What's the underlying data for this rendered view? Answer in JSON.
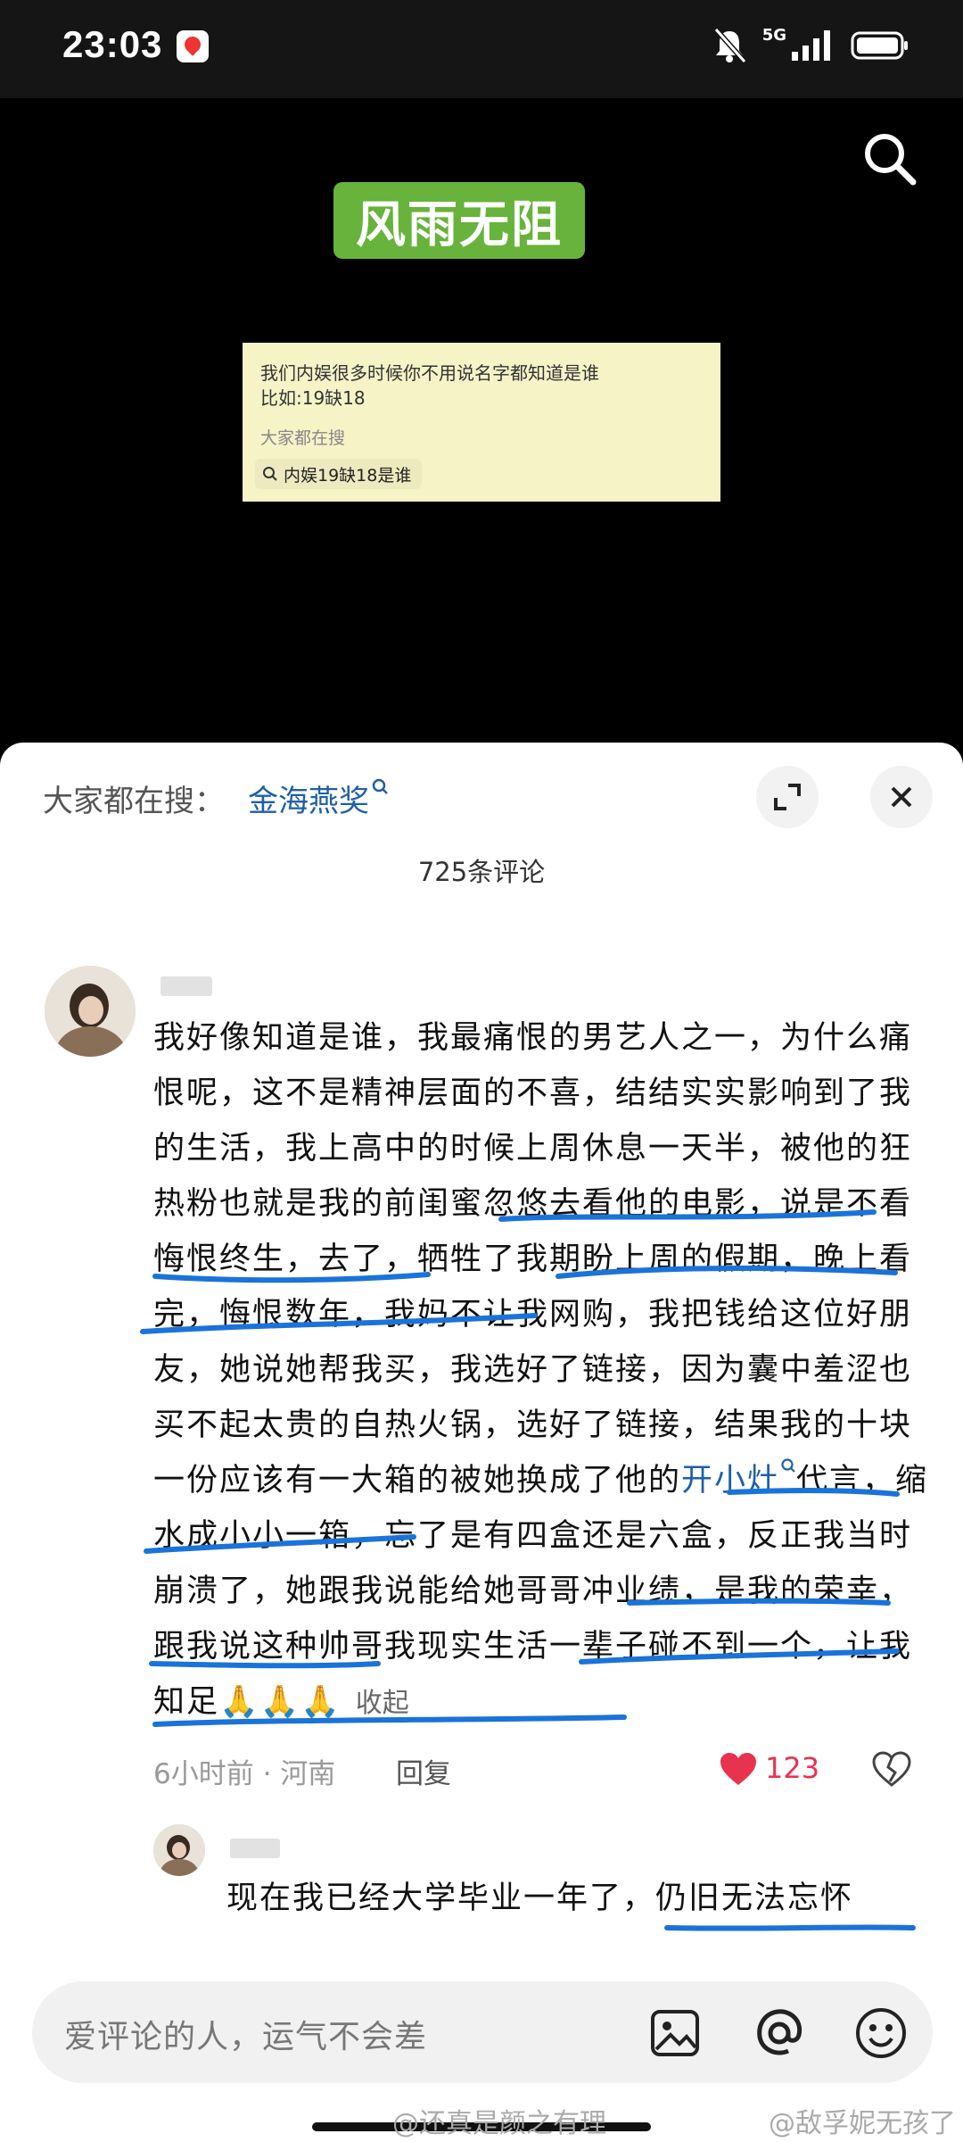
{
  "status_bar": {
    "time": "23:03",
    "network": "5G"
  },
  "video": {
    "tag": "风雨无阻",
    "card_line1": "我们内娱很多时候你不用说名字都知道是谁",
    "card_line2": "比如:19缺18",
    "card_hint": "大家都在搜",
    "card_query": "内娱19缺18是谁"
  },
  "sheet": {
    "hot_label": "大家都在搜：",
    "hot_link": "金海燕奖",
    "comment_count": "725条评论",
    "comment": {
      "text_a": "我好像知道是谁，我最痛恨的男艺人之一，为什么痛恨呢，这不是精神层面的不喜，结结实实影响到了我的生活，我上高中的时候上周休息一天半，被他的狂热粉也就是我的前闺蜜忽悠去看他的电影，说是不看悔恨终生，去了，牺牲了我期盼上周的假期，晚上看完，悔恨数年，我妈不让我网购，我把钱给这位好朋友，她说她帮我买，我选好了链接，因为囊中羞涩也买不起太贵的自热火锅，选好了链接，结果我的十块一份应该有一大箱的被她换成了他的",
      "link": "开小灶",
      "text_b": "代言，缩水成小小一箱，忘了是有四盒还是六盒，反正我当时崩溃了，她跟我说能给她哥哥冲业绩，是我的荣幸，跟我说这种帅哥我现实生活一辈子碰不到一个，让我知足🙏🙏🙏",
      "collapse": "收起",
      "meta": "6小时前 · 河南",
      "reply_label": "回复",
      "likes": "123"
    },
    "reply": {
      "text": "现在我已经大学毕业一年了，仍旧无法忘怀"
    },
    "input_placeholder": "爱评论的人，运气不会差"
  },
  "watermark": {
    "left": "@还真是颜之有理",
    "right": "@敌孚妮无孩了"
  },
  "colors": {
    "accent_link": "#1f5fa8",
    "like_red": "#e8334f",
    "ink_blue": "#1a73d9",
    "tag_green": "#67b33b"
  }
}
